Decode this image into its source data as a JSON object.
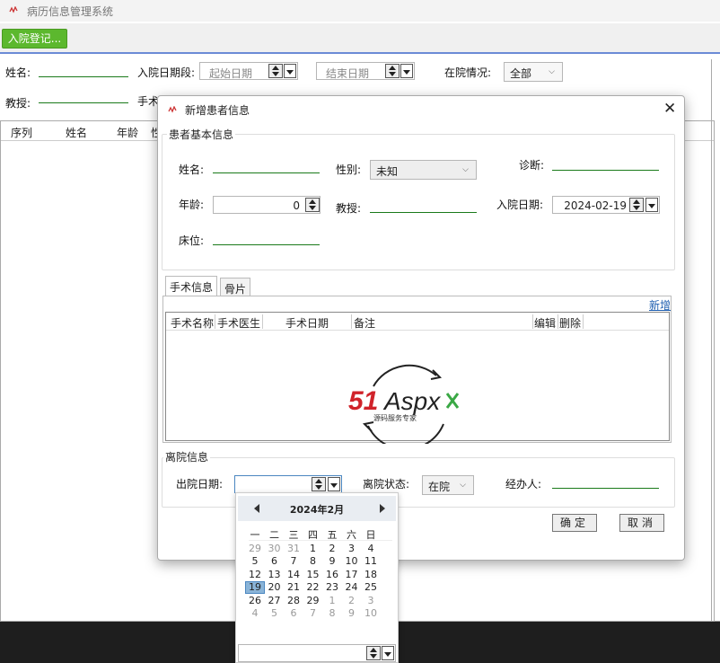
{
  "window": {
    "title": "病历信息管理系统"
  },
  "toolbar": {
    "admit_button": "入院登记..."
  },
  "filters": {
    "name_label": "姓名:",
    "admit_range_label": "入院日期段:",
    "start_date_placeholder": "起始日期",
    "end_date_placeholder": "结束日期",
    "status_label": "在院情况:",
    "status_value": "全部",
    "professor_label": "教授:",
    "surgery_label": "手术日期段"
  },
  "grid": {
    "columns": [
      "序列",
      "姓名",
      "年龄",
      "性"
    ]
  },
  "dialog": {
    "title": "新增患者信息",
    "basic_group": "患者基本信息",
    "name_label": "姓名:",
    "gender_label": "性别:",
    "gender_value": "未知",
    "diagnosis_label": "诊断:",
    "age_label": "年龄:",
    "age_value": "0",
    "professor_label": "教授:",
    "admit_date_label": "入院日期:",
    "admit_date_value": "2024-02-19",
    "bed_label": "床位:",
    "tabs": [
      "手术信息",
      "骨片"
    ],
    "add_link": "新增",
    "surgery_columns": [
      "手术名称",
      "手术医生",
      "手术日期",
      "备注",
      "编辑",
      "删除"
    ],
    "discharge_group": "离院信息",
    "discharge_date_label": "出院日期:",
    "discharge_status_label": "离院状态:",
    "discharge_status_value": "在院",
    "handler_label": "经办人:",
    "ok_button": "确定",
    "cancel_button": "取消"
  },
  "calendar": {
    "month": "2024年2月",
    "weekdays": [
      "一",
      "二",
      "三",
      "四",
      "五",
      "六",
      "日"
    ],
    "weeks": [
      [
        "29",
        "30",
        "31",
        "1",
        "2",
        "3",
        "4"
      ],
      [
        "5",
        "6",
        "7",
        "8",
        "9",
        "10",
        "11"
      ],
      [
        "12",
        "13",
        "14",
        "15",
        "16",
        "17",
        "18"
      ],
      [
        "19",
        "20",
        "21",
        "22",
        "23",
        "24",
        "25"
      ],
      [
        "26",
        "27",
        "28",
        "29",
        "1",
        "2",
        "3"
      ],
      [
        "4",
        "5",
        "6",
        "7",
        "8",
        "9",
        "10"
      ]
    ],
    "today": "19"
  },
  "watermark": {
    "brand": "51Aspx",
    "tagline": "源码服务专家"
  }
}
